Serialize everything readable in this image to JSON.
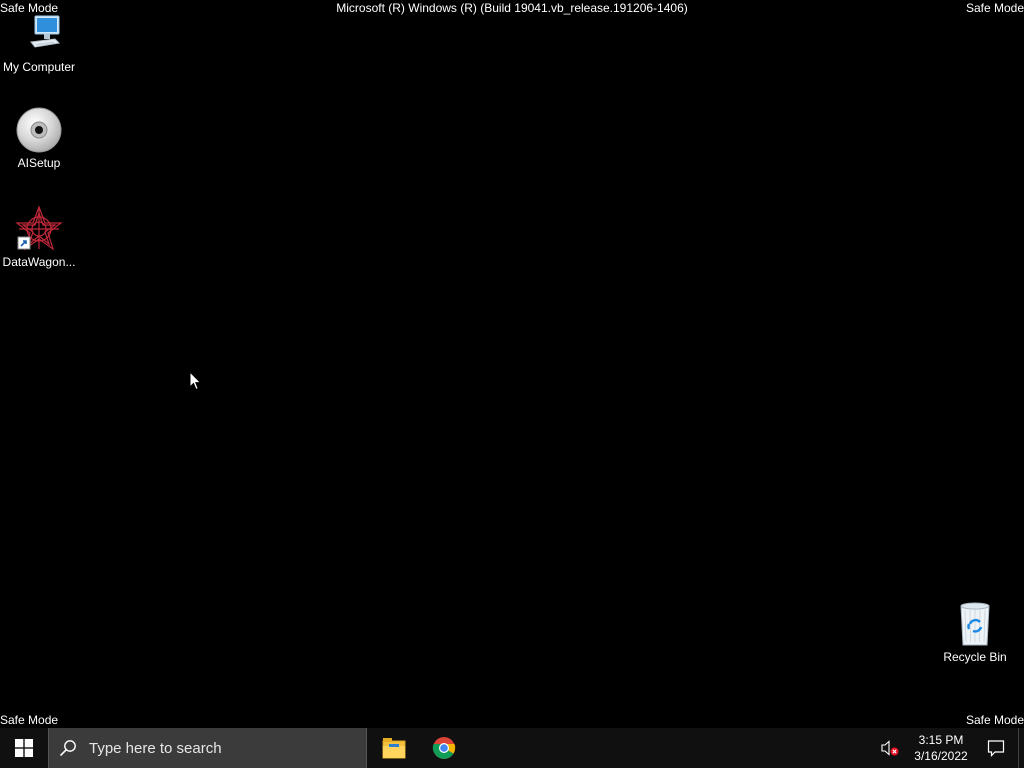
{
  "overlay": {
    "safe_mode_top_left": "Safe Mode",
    "safe_mode_top_right": "Safe Mode",
    "safe_mode_bottom_left": "Safe Mode",
    "safe_mode_bottom_right": "Safe Mode",
    "build_string": "Microsoft (R) Windows (R) (Build 19041.vb_release.191206-1406)"
  },
  "desktop_icons": [
    {
      "label": "My Computer",
      "icon": "computer-icon"
    },
    {
      "label": "AISetup",
      "icon": "cd-disc-icon"
    },
    {
      "label": "DataWagon...",
      "icon": "datawagon-shortcut-icon"
    },
    {
      "label": "Recycle Bin",
      "icon": "recycle-bin-icon"
    }
  ],
  "taskbar": {
    "search_placeholder": "Type here to search",
    "pinned_apps": [
      {
        "name": "File Explorer",
        "icon": "file-explorer-icon"
      },
      {
        "name": "Google Chrome",
        "icon": "chrome-icon"
      }
    ],
    "volume_icon": "volume-muted-icon",
    "clock_time": "3:15 PM",
    "clock_date": "3/16/2022"
  },
  "colors": {
    "desktop_bg": "#000000",
    "taskbar_bg": "#101010",
    "search_bg": "#3b3b3b",
    "windows_blue": "#0078d7"
  }
}
